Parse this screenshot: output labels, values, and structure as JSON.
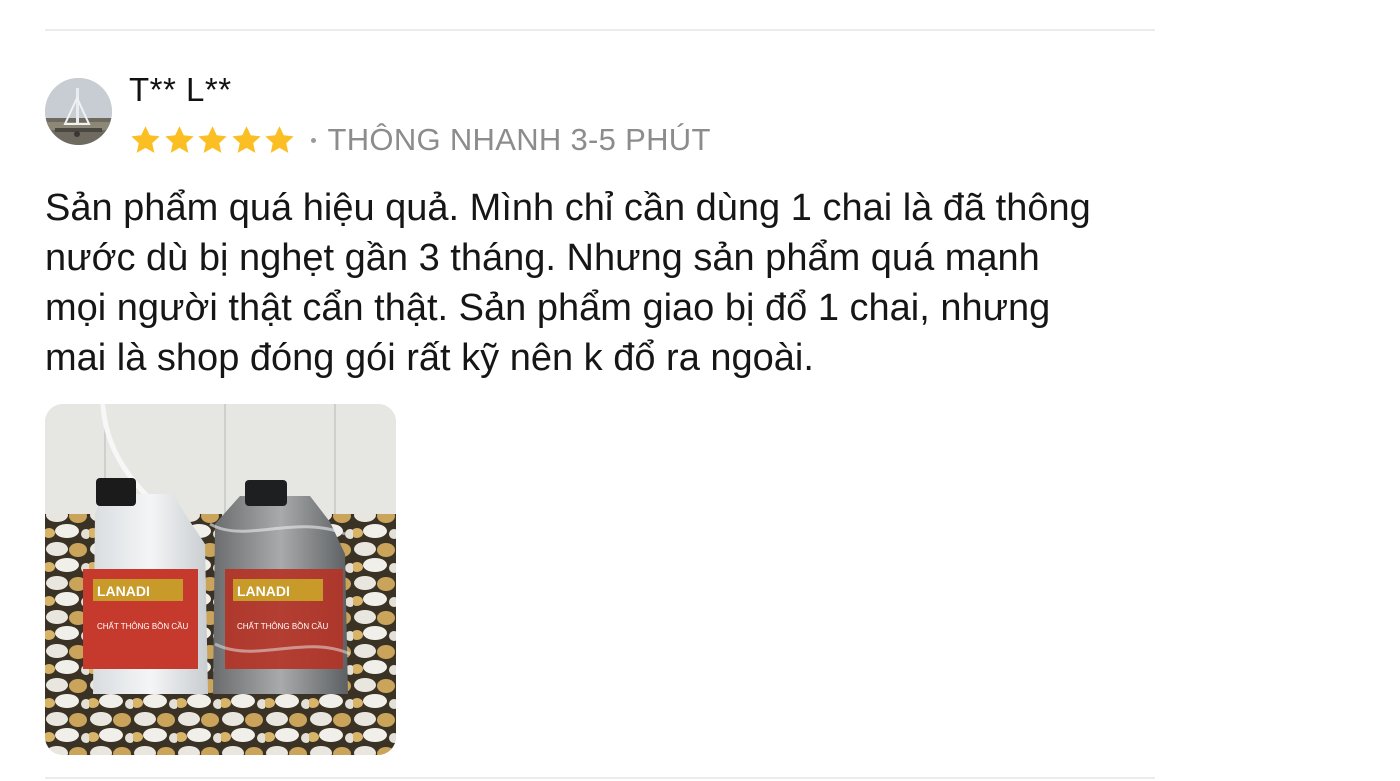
{
  "review": {
    "user": {
      "name": "T** L**",
      "avatar_icon": "avatar-photo"
    },
    "rating": {
      "value": 5,
      "max": 5,
      "star_color": "#fbbf24"
    },
    "variant": "THÔNG NHANH 3-5 PHÚT",
    "text_lines": [
      "Sản phẩm quá hiệu quả. Mình chỉ cần dùng 1 chai là đã thông",
      "nước dù bị nghẹt gần 3 tháng. Nhưng sản phẩm quá mạnh",
      "mọi người thật cẩn thật. Sản phẩm giao bị đổ 1 chai, nhưng",
      "mai là shop đóng gói rất kỹ nên k đổ ra ngoài."
    ],
    "photo": {
      "product_brand": "LANADI",
      "product_label": "CHẤT THÔNG BỒN CẦU"
    }
  }
}
